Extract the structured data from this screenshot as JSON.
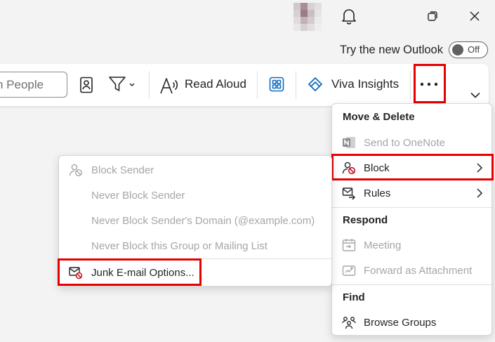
{
  "colors": {
    "highlight": "#e60000",
    "accent": "#0f6cbd",
    "disabled_text": "#a6a6a6",
    "block_icon_red": "#c50f1f"
  },
  "title_bar": {
    "icons": [
      "avatar",
      "bell-icon",
      "restore-icon",
      "close-icon"
    ]
  },
  "new_outlook": {
    "label": "Try the new Outlook",
    "toggle_state": "Off"
  },
  "ribbon": {
    "search_text": "n People",
    "items": [
      {
        "icon": "address-book-icon"
      },
      {
        "icon": "filter-icon"
      },
      {
        "icon": "read-aloud-icon",
        "label": "Read Aloud"
      },
      {
        "icon": "apps-grid-icon"
      },
      {
        "icon": "viva-insights-icon",
        "label": "Viva Insights"
      },
      {
        "icon": "more-options-icon"
      },
      {
        "icon": "chevron-down-icon"
      }
    ]
  },
  "more_menu": {
    "sections": [
      {
        "heading": "Move & Delete",
        "items": [
          {
            "label": "Send to OneNote",
            "icon": "onenote-icon",
            "enabled": false
          },
          {
            "label": "Block",
            "icon": "block-icon",
            "enabled": true,
            "has_submenu": true,
            "highlighted": true
          },
          {
            "label": "Rules",
            "icon": "rules-icon",
            "enabled": true,
            "has_submenu": true
          }
        ]
      },
      {
        "heading": "Respond",
        "items": [
          {
            "label": "Meeting",
            "icon": "meeting-icon",
            "enabled": false
          },
          {
            "label": "Forward as Attachment",
            "icon": "forward-attachment-icon",
            "enabled": false
          }
        ]
      },
      {
        "heading": "Find",
        "items": [
          {
            "label": "Browse Groups",
            "icon": "groups-icon",
            "enabled": true
          }
        ]
      }
    ]
  },
  "block_submenu": {
    "items": [
      {
        "label": "Block Sender",
        "icon": "block-sender-icon",
        "enabled": false
      },
      {
        "label": "Never Block Sender",
        "enabled": false
      },
      {
        "label": "Never Block Sender's Domain (@example.com)",
        "enabled": false
      },
      {
        "label": "Never Block this Group or Mailing List",
        "enabled": false
      },
      {
        "label": "Junk E-mail Options...",
        "icon": "junk-mail-icon",
        "enabled": true,
        "highlighted": true
      }
    ]
  }
}
